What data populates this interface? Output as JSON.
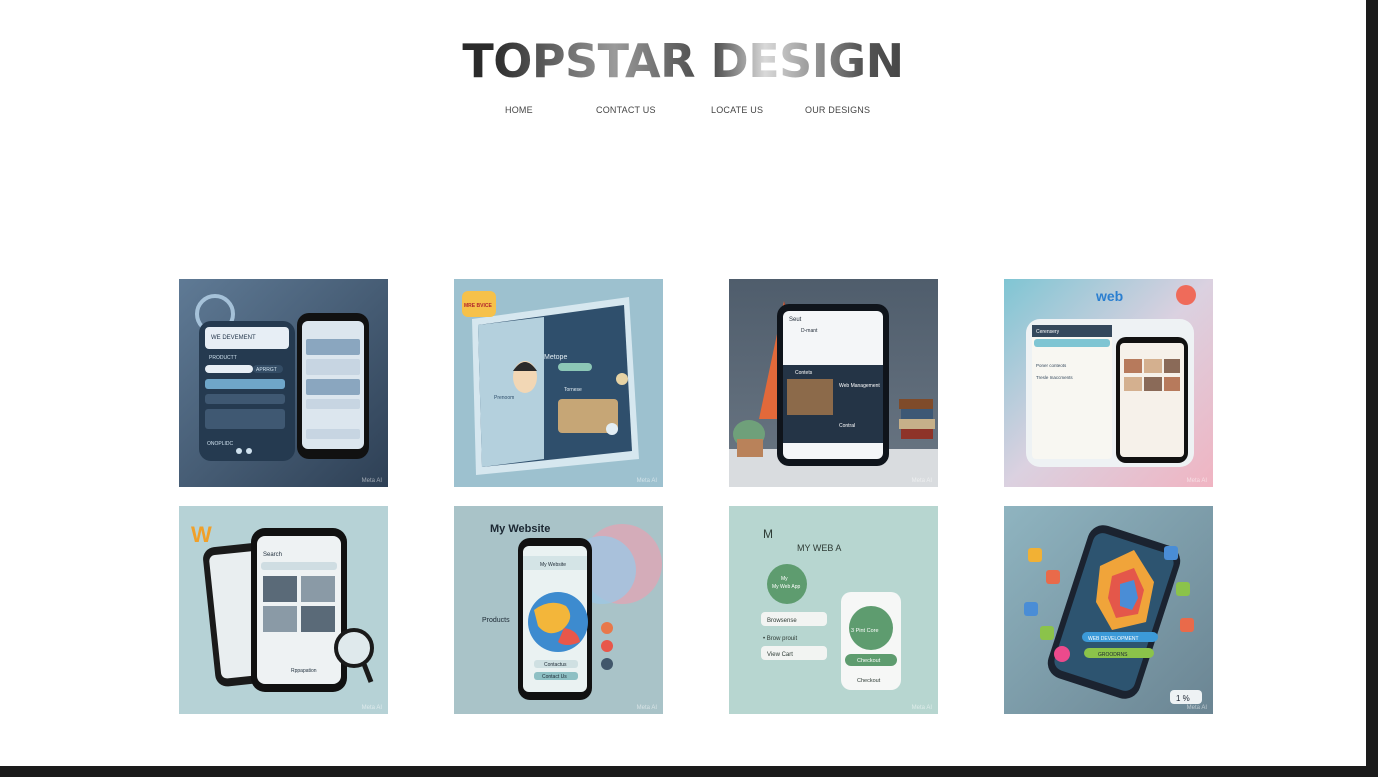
{
  "header": {
    "brand": "TOPSTAR DESIGN"
  },
  "nav": {
    "items": [
      {
        "label": "HOME"
      },
      {
        "label": "CONTACT US"
      },
      {
        "label": "LOCATE US"
      },
      {
        "label": "OUR DESIGNS"
      }
    ]
  },
  "gallery": {
    "watermark": "Meta AI",
    "tiles": [
      {
        "lines": [
          "WE DEVEMENT",
          "PRODUCTT",
          "APRRGT",
          "ONOPLIDC"
        ]
      },
      {
        "lines": [
          "MRE BVICE",
          "Metope",
          "Prenoom",
          "Tornese"
        ]
      },
      {
        "lines": [
          "Seut",
          "D-mant",
          "Contets",
          "Web Management",
          "Contral"
        ]
      },
      {
        "lines": [
          "web",
          "Cerensery",
          "Poner conteots",
          "Tresle Inaccments"
        ]
      },
      {
        "lines": [
          "Search",
          "Rppapation"
        ]
      },
      {
        "lines": [
          "My Website",
          "My Website",
          "Products",
          "Contactus",
          "Contact Us"
        ]
      },
      {
        "lines": [
          "MY WEB A",
          "My Web App",
          "Browsense",
          "• Brow prouit",
          "View Cart",
          "3 Pint Core",
          "Checkout",
          "Checkout"
        ]
      },
      {
        "lines": [
          "WEB DEVELOPMENT",
          "GROODRNS",
          "1 %"
        ]
      }
    ]
  },
  "colors": {
    "page_bg": "#ffffff",
    "frame": "#1b1b1b",
    "nav_text": "#444444"
  }
}
